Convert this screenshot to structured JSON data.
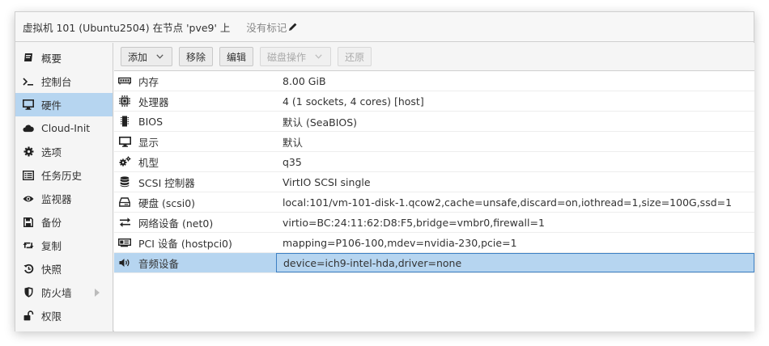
{
  "title": {
    "vm_label": "虚拟机 101 (Ubuntu2504) 在节点 'pve9' 上",
    "no_tags": "没有标记"
  },
  "sidebar": {
    "items": [
      {
        "label": "概要",
        "icon": "book-icon"
      },
      {
        "label": "控制台",
        "icon": "terminal-icon"
      },
      {
        "label": "硬件",
        "icon": "desktop-icon",
        "active": true
      },
      {
        "label": "Cloud-Init",
        "icon": "cloud-icon"
      },
      {
        "label": "选项",
        "icon": "gear-icon"
      },
      {
        "label": "任务历史",
        "icon": "list-icon"
      },
      {
        "label": "监视器",
        "icon": "eye-icon"
      },
      {
        "label": "备份",
        "icon": "floppy-icon"
      },
      {
        "label": "复制",
        "icon": "retweet-icon"
      },
      {
        "label": "快照",
        "icon": "history-icon"
      },
      {
        "label": "防火墙",
        "icon": "shield-icon",
        "has_submenu": true
      },
      {
        "label": "权限",
        "icon": "unlock-icon"
      }
    ]
  },
  "toolbar": {
    "add": "添加",
    "remove": "移除",
    "edit": "编辑",
    "disk_action": "磁盘操作",
    "revert": "还原"
  },
  "hardware": {
    "rows": [
      {
        "name": "内存",
        "value": "8.00 GiB",
        "icon": "memory-icon"
      },
      {
        "name": "处理器",
        "value": "4 (1 sockets, 4 cores) [host]",
        "icon": "cpu-icon"
      },
      {
        "name": "BIOS",
        "value": "默认 (SeaBIOS)",
        "icon": "microchip-icon"
      },
      {
        "name": "显示",
        "value": "默认",
        "icon": "desktop-icon"
      },
      {
        "name": "机型",
        "value": "q35",
        "icon": "cogs-icon"
      },
      {
        "name": "SCSI 控制器",
        "value": "VirtIO SCSI single",
        "icon": "database-icon"
      },
      {
        "name": "硬盘 (scsi0)",
        "value": "local:101/vm-101-disk-1.qcow2,cache=unsafe,discard=on,iothread=1,size=100G,ssd=1",
        "icon": "hdd-icon"
      },
      {
        "name": "网络设备 (net0)",
        "value": "virtio=BC:24:11:62:D8:F5,bridge=vmbr0,firewall=1",
        "icon": "exchange-icon"
      },
      {
        "name": "PCI 设备 (hostpci0)",
        "value": "mapping=P106-100,mdev=nvidia-230,pcie=1",
        "icon": "pci-card-icon"
      },
      {
        "name": "音频设备",
        "value": "device=ich9-intel-hda,driver=none",
        "icon": "volume-icon",
        "selected": true
      }
    ]
  }
}
